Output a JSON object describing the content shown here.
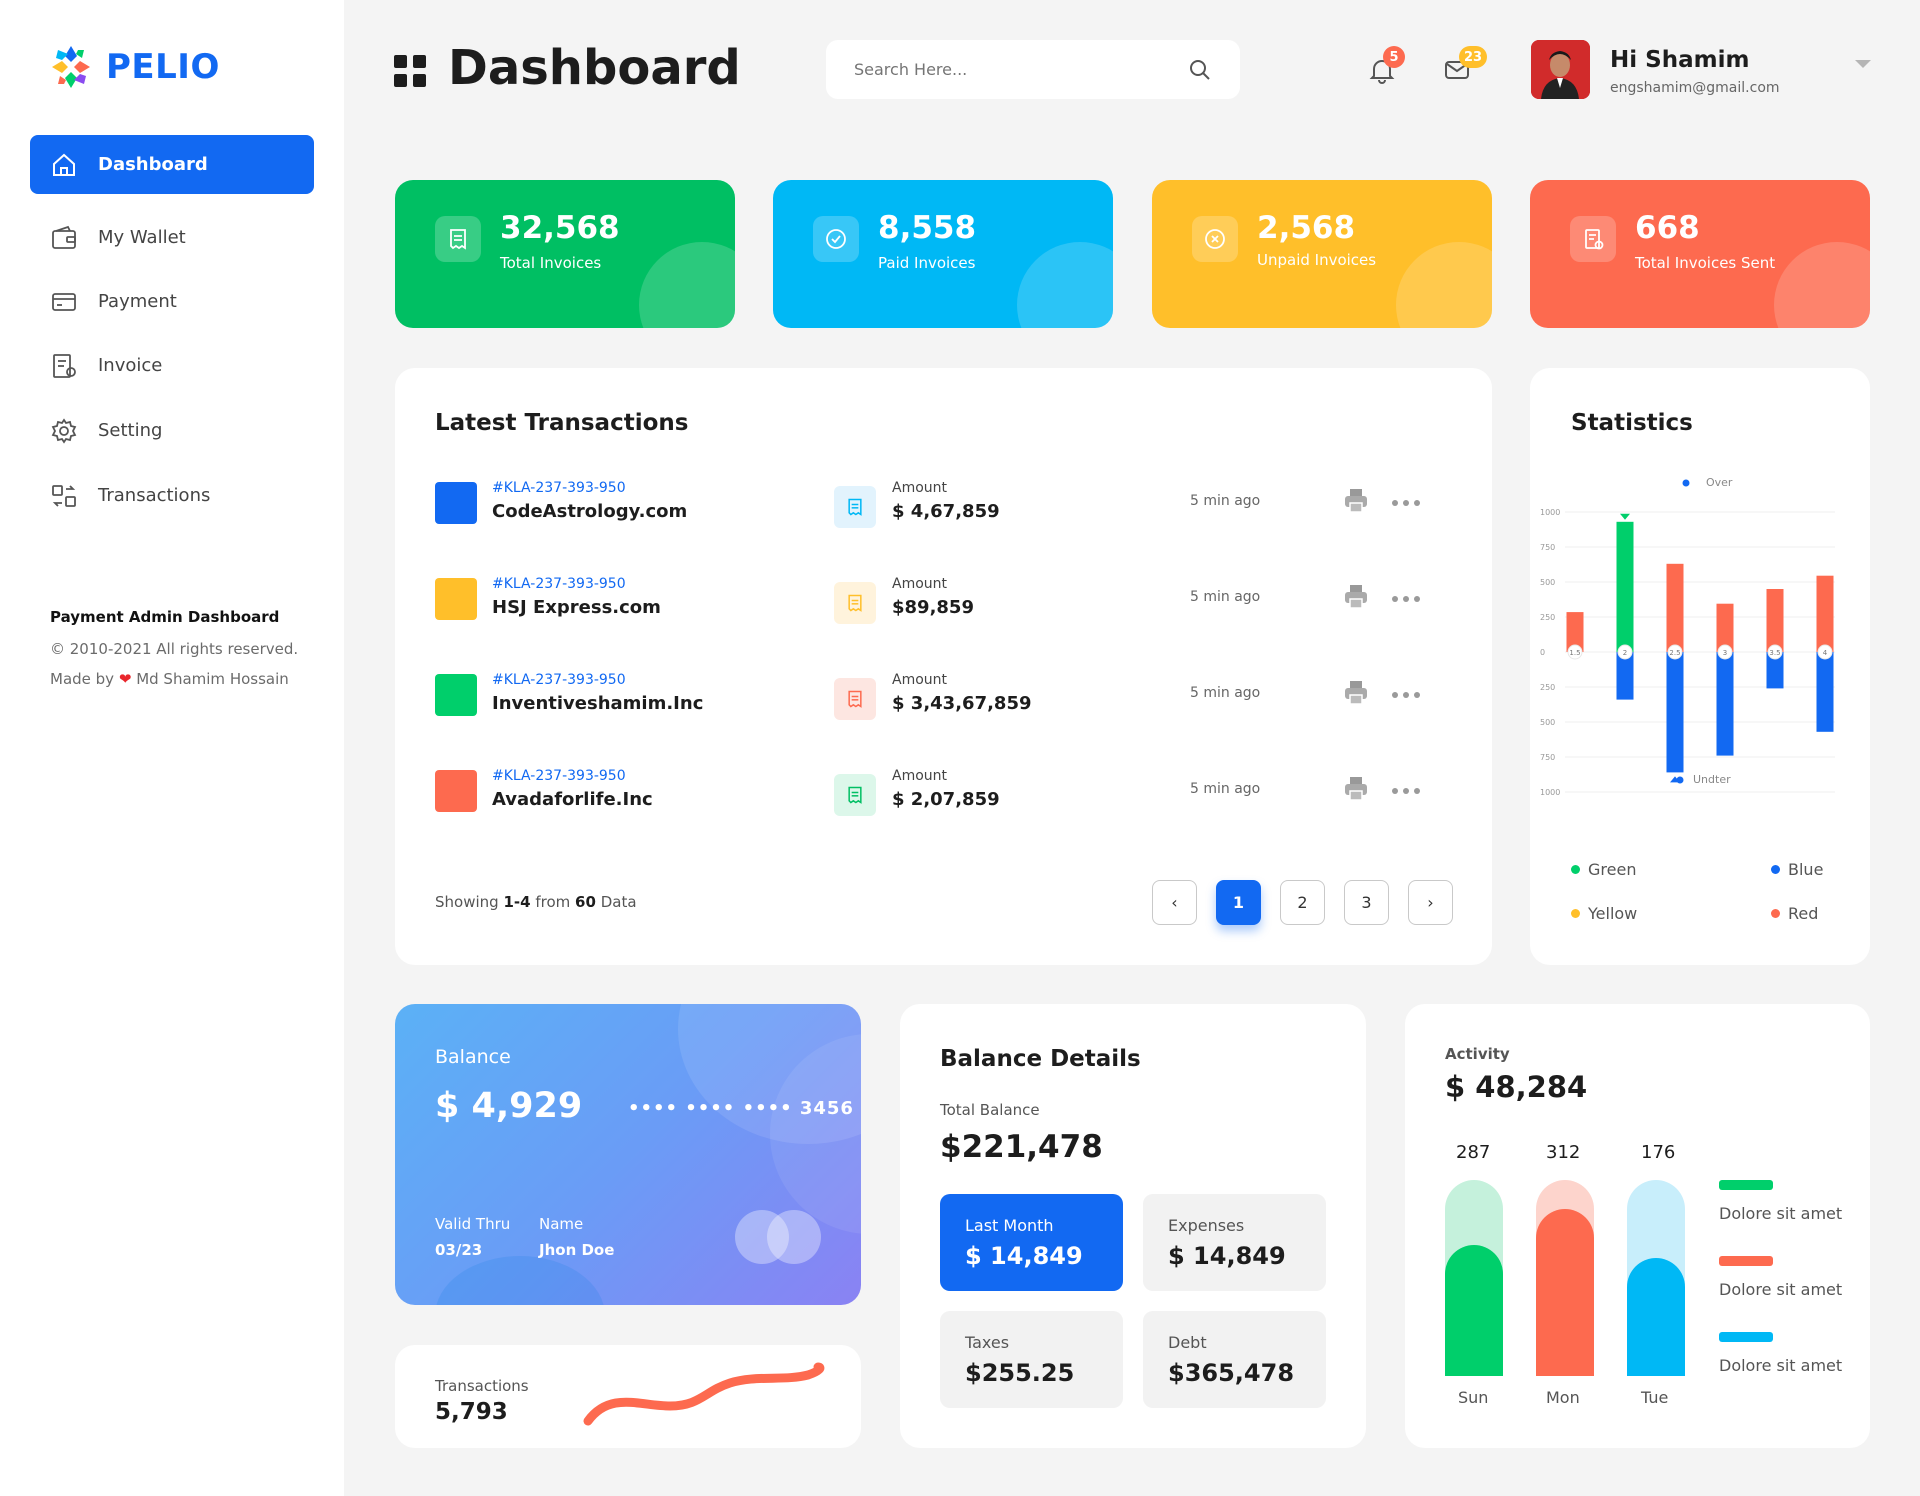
{
  "sidebar": {
    "brand": "PELIO",
    "items": [
      {
        "label": "Dashboard",
        "icon": "home-icon",
        "active": true
      },
      {
        "label": "My Wallet",
        "icon": "wallet-icon"
      },
      {
        "label": "Payment",
        "icon": "credit-card-icon"
      },
      {
        "label": "Invoice",
        "icon": "invoice-icon"
      },
      {
        "label": "Setting",
        "icon": "gear-icon"
      },
      {
        "label": "Transactions",
        "icon": "transactions-icon"
      }
    ],
    "footer": {
      "title": "Payment Admin Dashboard",
      "copyright": "© 2010-2021 All rights reserved.",
      "made_by_prefix": "Made by",
      "made_by_name": "Md Shamim Hossain"
    }
  },
  "header": {
    "title": "Dashboard",
    "search_placeholder": "Search Here...",
    "notifications_count": "5",
    "messages_count": "23",
    "user_greeting": "Hi Shamim",
    "user_email": "engshamim@gmail.com"
  },
  "stats": [
    {
      "value": "32,568",
      "label": "Total Invoices",
      "color": "#00bf63"
    },
    {
      "value": "8,558",
      "label": "Paid Invoices",
      "color": "#00b8f5"
    },
    {
      "value": "2,568",
      "label": "Unpaid Invoices",
      "color": "#ffbf2a"
    },
    {
      "value": "668",
      "label": "Total Invoices Sent",
      "color": "#fd6a4f"
    }
  ],
  "transactions": {
    "title": "Latest Transactions",
    "rows": [
      {
        "id": "#KLA-237-393-950",
        "name": "CodeAstrology.com",
        "amount_label": "Amount",
        "amount": "$ 4,67,859",
        "time": "5 min ago",
        "color": "#1269f2"
      },
      {
        "id": "#KLA-237-393-950",
        "name": "HSJ Express.com",
        "amount_label": "Amount",
        "amount": "$89,859",
        "time": "5 min ago",
        "color": "#ffbf2a"
      },
      {
        "id": "#KLA-237-393-950",
        "name": "Inventiveshamim.Inc",
        "amount_label": "Amount",
        "amount": "$ 3,43,67,859",
        "time": "5 min ago",
        "color": "#00cf6b"
      },
      {
        "id": "#KLA-237-393-950",
        "name": "Avadaforlife.Inc",
        "amount_label": "Amount",
        "amount": "$ 2,07,859",
        "time": "5 min ago",
        "color": "#fd6a4f"
      }
    ],
    "showing_prefix": "Showing",
    "showing_range": "1-4",
    "showing_from": "from",
    "showing_total": "60",
    "showing_suffix": "Data",
    "pages": [
      "1",
      "2",
      "3"
    ],
    "current_page": "1"
  },
  "statistics": {
    "title": "Statistics",
    "legend": [
      {
        "label": "Green",
        "color": "#00cf6b"
      },
      {
        "label": "Blue",
        "color": "#1269f2"
      },
      {
        "label": "Yellow",
        "color": "#ffbf2a"
      },
      {
        "label": "Red",
        "color": "#fd6a4f"
      }
    ]
  },
  "chart_data": {
    "type": "bar",
    "top_label": "Over",
    "bottom_label": "Undter",
    "y_ticks": [
      "1000",
      "750",
      "500",
      "250",
      "0",
      "250",
      "500",
      "750",
      "1000"
    ],
    "x": [
      "1.5",
      "2",
      "2.5",
      "3",
      "3.5",
      "4"
    ],
    "series": [
      {
        "name": "Over",
        "values": [
          285,
          930,
          630,
          345,
          450,
          545
        ]
      },
      {
        "name": "Undter",
        "values": [
          0,
          -340,
          -860,
          -740,
          -260,
          -570
        ]
      }
    ],
    "over_colors": [
      "#fd6a4f",
      "#00cf6b",
      "#fd6a4f",
      "#fd6a4f",
      "#fd6a4f",
      "#fd6a4f"
    ],
    "ylim": [
      -1000,
      1000
    ]
  },
  "balance_card": {
    "label": "Balance",
    "amount": "$ 4,929",
    "card_number": "•••• •••• •••• 3456",
    "valid_label": "Valid Thru",
    "valid_value": "03/23",
    "name_label": "Name",
    "name_value": "Jhon Doe"
  },
  "transactions_mini": {
    "label": "Transactions",
    "value": "5,793"
  },
  "balance_details": {
    "title": "Balance Details",
    "total_label": "Total Balance",
    "total_value": "$221,478",
    "boxes": [
      {
        "label": "Last Month",
        "value": "$ 14,849"
      },
      {
        "label": "Expenses",
        "value": "$ 14,849"
      },
      {
        "label": "Taxes",
        "value": "$255.25"
      },
      {
        "label": "Debt",
        "value": "$365,478"
      }
    ]
  },
  "activity": {
    "label": "Activity",
    "value": "$ 48,284",
    "bars": [
      {
        "day": "Sun",
        "value": "287",
        "fill_fraction": 0.67,
        "color": "#00cf6b",
        "bg": "#c5f1dc"
      },
      {
        "day": "Mon",
        "value": "312",
        "fill_fraction": 0.85,
        "color": "#fd6a4f",
        "bg": "#fdd4cc"
      },
      {
        "day": "Tue",
        "value": "176",
        "fill_fraction": 0.6,
        "color": "#00b8f5",
        "bg": "#c8eefb"
      }
    ],
    "legend": [
      {
        "label": "Dolore sit amet",
        "color": "#00cf6b"
      },
      {
        "label": "Dolore sit amet",
        "color": "#fd6a4f"
      },
      {
        "label": "Dolore sit amet",
        "color": "#00b8f5"
      }
    ]
  }
}
